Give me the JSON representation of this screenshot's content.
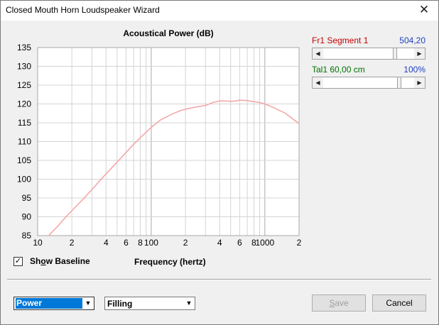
{
  "window": {
    "title": "Closed Mouth Horn Loudspeaker Wizard",
    "close_glyph": "✕"
  },
  "chart_data": {
    "type": "line",
    "title": "Acoustical Power (dB)",
    "xlabel": "Frequency (hertz)",
    "ylabel": "",
    "xscale": "log",
    "xlim": [
      10,
      2000
    ],
    "ylim": [
      85,
      135
    ],
    "yticks": [
      85,
      90,
      95,
      100,
      105,
      110,
      115,
      120,
      125,
      130,
      135
    ],
    "xtick_labels": [
      {
        "x": 10,
        "label": "10"
      },
      {
        "x": 20,
        "label": "2"
      },
      {
        "x": 40,
        "label": "4"
      },
      {
        "x": 60,
        "label": "6"
      },
      {
        "x": 80,
        "label": "8"
      },
      {
        "x": 100,
        "label": "100"
      },
      {
        "x": 200,
        "label": "2"
      },
      {
        "x": 400,
        "label": "4"
      },
      {
        "x": 600,
        "label": "6"
      },
      {
        "x": 800,
        "label": "8"
      },
      {
        "x": 1000,
        "label": "1000"
      },
      {
        "x": 2000,
        "label": "2"
      }
    ],
    "grid": true,
    "line_color": "#f4a8a8",
    "series": [
      {
        "x": [
          12.5,
          15,
          18,
          20,
          25,
          30,
          35,
          40,
          50,
          60,
          70,
          80,
          100,
          120,
          150,
          180,
          200,
          250,
          300,
          350,
          400,
          450,
          500,
          550,
          600,
          700,
          800,
          900,
          1000,
          1200,
          1500,
          1800,
          2000
        ],
        "y": [
          85,
          87.5,
          90.2,
          91.6,
          94.6,
          97.2,
          99.5,
          101.4,
          104.5,
          107.1,
          109.3,
          111.0,
          113.8,
          115.7,
          117.2,
          118.2,
          118.6,
          119.2,
          119.6,
          120.4,
          120.8,
          120.8,
          120.7,
          120.8,
          121.0,
          120.9,
          120.6,
          120.4,
          120.0,
          119.0,
          117.6,
          115.8,
          114.8
        ]
      }
    ]
  },
  "segment": {
    "name": "Fr1  Segment 1",
    "value": "504,20",
    "name_color": "#c00000",
    "value_color": "#1f3fbf",
    "slider_fraction": 0.8
  },
  "taper": {
    "name": "Tal1  60,00 cm",
    "value": "100%",
    "name_color": "#007000",
    "value_color": "#1f3fbf",
    "slider_fraction": 0.85
  },
  "slider_arrows": {
    "left": "◀",
    "right": "▶"
  },
  "show_baseline": {
    "label_pre": "Sh",
    "label_key": "o",
    "label_mid": "w ",
    "label_key2": "B",
    "label_post": "aseline",
    "checked": true,
    "check_glyph": "✓"
  },
  "controls": {
    "plot_select": "Power",
    "fill_select": "Filling",
    "drop_glyph": "▼",
    "save_pre": "",
    "save_key": "S",
    "save_post": "ave",
    "cancel_label": "Cancel"
  }
}
